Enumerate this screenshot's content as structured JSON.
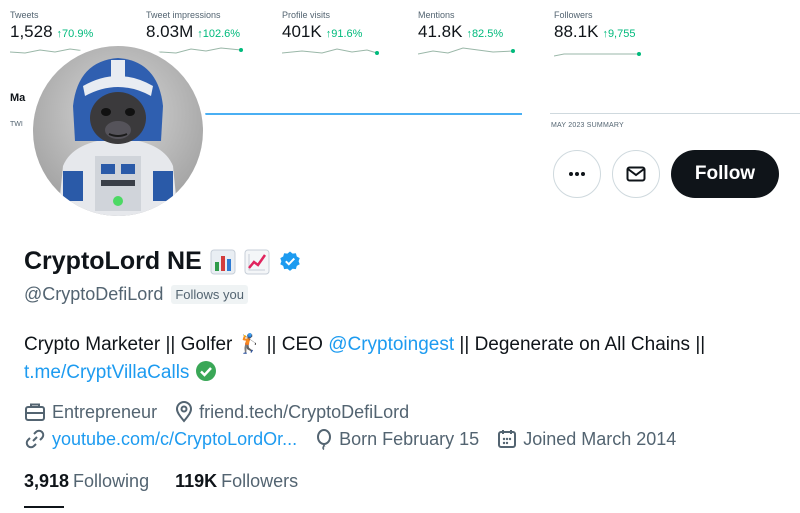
{
  "banner": {
    "stats": [
      {
        "label": "Tweets",
        "value": "1,528",
        "change": "↑70.9%"
      },
      {
        "label": "Tweet impressions",
        "value": "8.03M",
        "change": "↑102.6%"
      },
      {
        "label": "Profile visits",
        "value": "401K",
        "change": "↑91.6%"
      },
      {
        "label": "Mentions",
        "value": "41.8K",
        "change": "↑82.5%"
      },
      {
        "label": "Followers",
        "value": "88.1K",
        "change": "↑9,755"
      }
    ],
    "title": "Ma",
    "sub": "TWI",
    "summary": "MAY 2023 SUMMARY"
  },
  "actions": {
    "follow_label": "Follow"
  },
  "profile": {
    "name": "CryptoLord NE",
    "handle": "@CryptoDefiLord",
    "follows_you": "Follows you",
    "bio": {
      "part1": "Crypto Marketer || Golfer 🏌 || CEO ",
      "mention": "@Cryptoingest",
      "part2": " || Degenerate on All Chains ||",
      "link": "t.me/CryptVillaCalls"
    },
    "profession": "Entrepreneur",
    "location": "friend.tech/CryptoDefiLord",
    "website": "youtube.com/c/CryptoLordOr...",
    "birthday": "Born February 15",
    "joined": "Joined March 2014",
    "following_count": "3,918",
    "following_label": "Following",
    "followers_count": "119K",
    "followers_label": "Followers"
  },
  "colors": {
    "accent": "#1d9bf0",
    "positive": "#00ba7c",
    "verified": "#1d9bf0",
    "text": "#0f1419",
    "muted": "#536471"
  }
}
